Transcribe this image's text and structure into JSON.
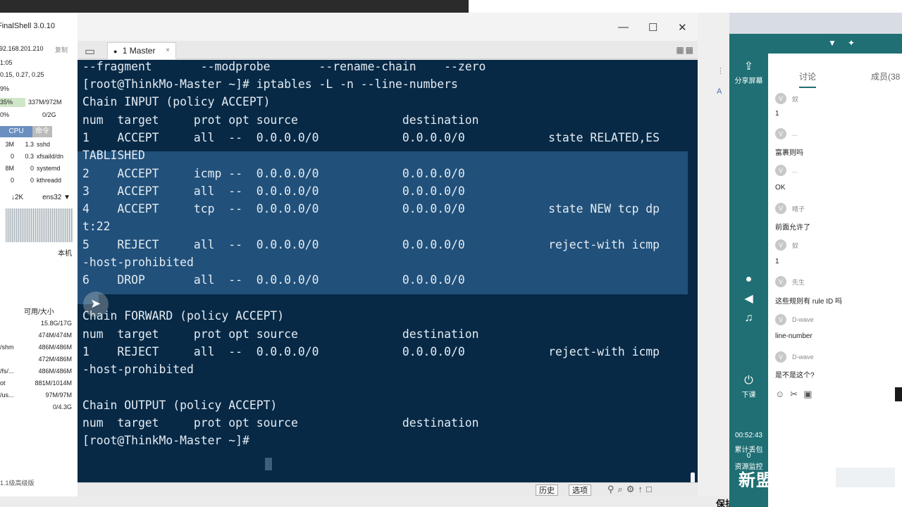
{
  "app": {
    "title": "FinalShell 3.0.10"
  },
  "monitor": {
    "ip": "192.168.201.210",
    "copy_label": "复制",
    "uptime": "1:05",
    "load": "0.15, 0.27, 0.25",
    "cpu": "9%",
    "mem_pct": "35%",
    "mem": "337M/972M",
    "swap_pct": "0%",
    "swap": "0/2G",
    "tabs": [
      "CPU",
      "命令"
    ],
    "processes": [
      {
        "mem": "3M",
        "cpu": "1.3",
        "name": "sshd"
      },
      {
        "mem": "0",
        "cpu": "0.3",
        "name": "xfsaild/dn"
      },
      {
        "mem": "8M",
        "cpu": "0",
        "name": "systemd"
      },
      {
        "mem": "0",
        "cpu": "0",
        "name": "kthreadd"
      }
    ],
    "net_rate": "↓2K",
    "net_iface": "ens32 ▼",
    "local_label": "本机",
    "disk_header": "可用/大小",
    "disks": [
      {
        "mount": "",
        "size": "15.8G/17G"
      },
      {
        "mount": "",
        "size": "474M/474M"
      },
      {
        "mount": "/shm",
        "size": "486M/486M"
      },
      {
        "mount": "",
        "size": "472M/486M"
      },
      {
        "mount": "/fs/...",
        "size": "486M/486M"
      },
      {
        "mount": "ot",
        "size": "881M/1014M"
      },
      {
        "mount": "/us...",
        "size": "97M/97M"
      },
      {
        "mount": "",
        "size": "0/4.3G"
      }
    ],
    "bottom_label": "1.1级高级版"
  },
  "window": {
    "min": "—",
    "max": "☐",
    "close": "✕"
  },
  "tab": {
    "dot": "●",
    "label": "1 Master",
    "close": "×"
  },
  "terminal": {
    "lines": [
      "--fragment       --modprobe       --rename-chain    --zero",
      "[root@ThinkMo-Master ~]# iptables -L -n --line-numbers",
      "Chain INPUT (policy ACCEPT)",
      "num  target     prot opt source               destination",
      "1    ACCEPT     all  --  0.0.0.0/0            0.0.0.0/0            state RELATED,ES",
      "TABLISHED",
      "2    ACCEPT     icmp --  0.0.0.0/0            0.0.0.0/0",
      "3    ACCEPT     all  --  0.0.0.0/0            0.0.0.0/0",
      "4    ACCEPT     tcp  --  0.0.0.0/0            0.0.0.0/0            state NEW tcp dp",
      "t:22",
      "5    REJECT     all  --  0.0.0.0/0            0.0.0.0/0            reject-with icmp",
      "-host-prohibited",
      "6    DROP       all  --  0.0.0.0/0            0.0.0.0/0",
      "",
      "Chain FORWARD (policy ACCEPT)",
      "num  target     prot opt source               destination",
      "1    REJECT     all  --  0.0.0.0/0            0.0.0.0/0            reject-with icmp",
      "-host-prohibited",
      "",
      "Chain OUTPUT (policy ACCEPT)",
      "num  target     prot opt source               destination",
      "[root@ThinkMo-Master ~]# "
    ]
  },
  "bottombar": {
    "history": "历史",
    "options": "选项"
  },
  "footer": {
    "text": "保护云服务器"
  },
  "meeting": {
    "share_label": "分享屏幕",
    "leave_label": "下课",
    "time": "00:52:43",
    "stats1": "累计丢包",
    "stats2": "0",
    "stats3": "资源监控",
    "tabs": [
      "讨论",
      "成员(38"
    ],
    "messages": [
      {
        "name": "奴",
        "text": "1"
      },
      {
        "name": "...",
        "text": "富裹则吗"
      },
      {
        "name": "...",
        "text": "OK"
      },
      {
        "name": "晴子",
        "text": "前面允许了"
      },
      {
        "name": "奴",
        "text": "1"
      },
      {
        "name": "先生",
        "text": "这些规则有 rule ID 吗"
      },
      {
        "name": "D-wave",
        "text": "line-number"
      },
      {
        "name": "D-wave",
        "text": "是不是这个?"
      }
    ],
    "watermark": "新盟"
  }
}
